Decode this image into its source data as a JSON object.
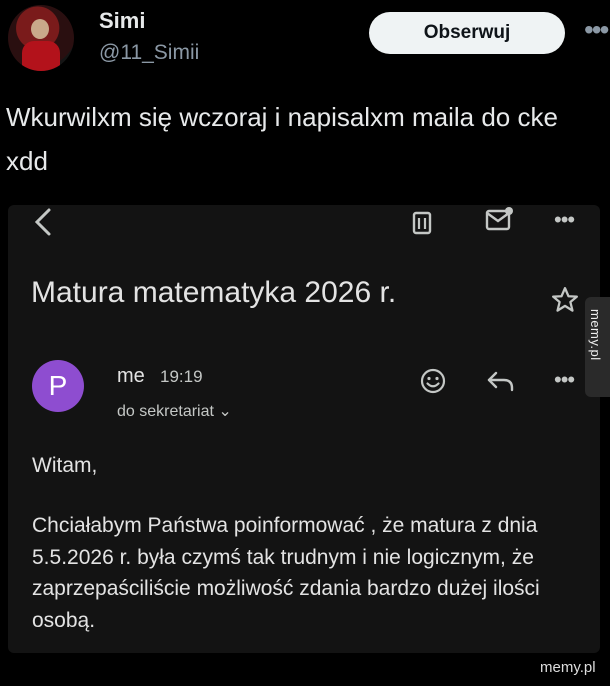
{
  "tweet": {
    "author_name": "Simi",
    "author_handle": "@11_Simii",
    "follow_label": "Obserwuj",
    "text": "Wkurwilxm się wczoraj i napisalxm maila do cke xdd"
  },
  "email": {
    "subject": "Matura matematyka 2026 r.",
    "avatar_letter": "P",
    "sender": "me",
    "time": "19:19",
    "recipient": "do sekretariat ⌄",
    "greeting": "Witam,",
    "body": "Chciałabym Państwa poinformować , że matura z dnia 5.5.2026 r. była czymś tak trudnym i nie logicznym, że zaprzepaściliście możliwość zdania bardzo dużej ilości osobą.",
    "avatar_color": "#8e4dd0",
    "icons": [
      "back-icon",
      "trash-icon",
      "mark-unread-icon",
      "more-icon",
      "star-icon",
      "emoji-icon",
      "reply-icon"
    ]
  },
  "watermarks": {
    "side": "memy.pl",
    "bottom": "memy.pl"
  }
}
